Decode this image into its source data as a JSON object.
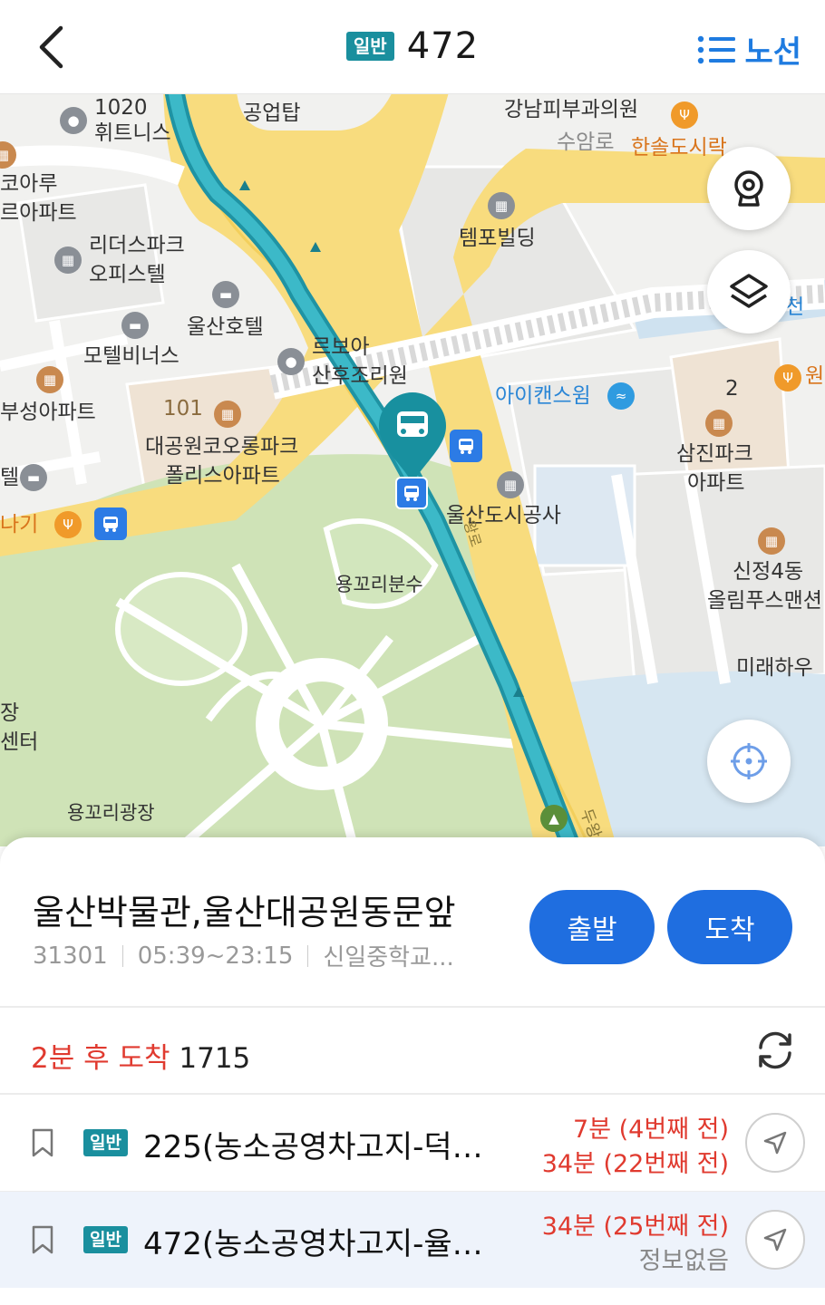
{
  "header": {
    "back_icon": "chevron-left-icon",
    "type_badge": "일반",
    "route_number": "472",
    "route_button_label": "노선",
    "route_button_icon": "list-icon"
  },
  "map": {
    "labels": {
      "l1020": "1020",
      "hwitness": "휘트니스",
      "gongeoptap": "공업탑",
      "gangnam": "강남피부과의원",
      "suamro": "수암로",
      "hansol": "한솔도시락",
      "koaru": "코아루",
      "apt1": "르아파트",
      "lidus": "리더스파크",
      "officetel": "오피스텔",
      "tempo": "템포빌딩",
      "ulsanhotel": "울산호텔",
      "motel": "모텔비너스",
      "rebo": "르보아",
      "sanhu": "산후조리원",
      "icans": "아이캔스윔",
      "n2": "2",
      "won": "원",
      "busung": "부성아파트",
      "n101": "101",
      "daegongwon": "대공원코오롱파크",
      "police": "폴리스아파트",
      "samjin1": "삼진파크",
      "samjin2": "아파트",
      "tel": "텔",
      "naki": "나기",
      "urbancorp": "울산도시공사",
      "sinjeong1": "신정4동",
      "sinjeong2": "올림푸스맨션",
      "yongfountain": "용꼬리분수",
      "mirae": "미래하우",
      "jang": "장",
      "center": "센터",
      "yongplaza": "용꼬리광장",
      "road1": "왕로",
      "duwang": "두왕",
      "cheon": "천"
    },
    "cctv_icon": "cctv-icon",
    "layers_icon": "layers-icon",
    "locate_icon": "crosshair-icon",
    "pin_icon": "bus-pin-icon"
  },
  "stop": {
    "name": "울산박물관,울산대공원동문앞",
    "id": "31301",
    "hours": "05:39~23:15",
    "direction": "신일중학교...",
    "depart_label": "출발",
    "arrive_label": "도착"
  },
  "arrival": {
    "time_text": "2분 후 도착",
    "vehicle": "1715",
    "refresh_icon": "refresh-icon"
  },
  "buses": [
    {
      "badge": "일반",
      "title": "225(농소공영차고지-덕…",
      "eta1": "7분 (4번째 전)",
      "eta2": "34분 (22번째 전)"
    },
    {
      "badge": "일반",
      "title": "472(농소공영차고지-율…",
      "eta1": "34분 (25번째 전)",
      "eta2": "정보없음"
    }
  ],
  "colors": {
    "accent": "#1f6ee0",
    "badge": "#1a8f9e",
    "alert": "#e03a2f",
    "route_line": "#2aa6b8",
    "road": "#f8dc7e",
    "park": "#cfe3b7",
    "water": "#d8e8f3"
  }
}
